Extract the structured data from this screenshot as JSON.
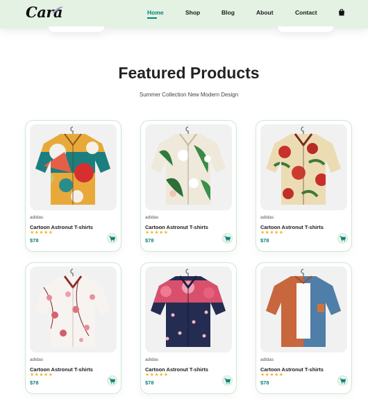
{
  "header": {
    "logo_text": "Cara",
    "nav": [
      {
        "label": "Home",
        "active": true
      },
      {
        "label": "Shop",
        "active": false
      },
      {
        "label": "Blog",
        "active": false
      },
      {
        "label": "About",
        "active": false
      },
      {
        "label": "Contact",
        "active": false
      }
    ],
    "bag_icon": "shopping-bag-icon"
  },
  "section": {
    "title": "Featured Products",
    "subtitle": "Summer Collection New Modern Design"
  },
  "colors": {
    "accent": "#088178",
    "header_bg": "#e3f2e3",
    "star": "#f3b52c",
    "card_border": "#cce7d0"
  },
  "products": [
    {
      "brand": "adidas",
      "name": "Cartoon Astronut T-shirts",
      "stars": "★★★★★",
      "price": "$78",
      "image": "yellow-teal-floral-shirt"
    },
    {
      "brand": "adidas",
      "name": "Cartoon Astronut T-shirts",
      "stars": "★★★★★",
      "price": "$78",
      "image": "white-green-leaf-shirt"
    },
    {
      "brand": "adidas",
      "name": "Cartoon Astronut T-shirts",
      "stars": "★★★★★",
      "price": "$78",
      "image": "beige-red-floral-shirt"
    },
    {
      "brand": "adidas",
      "name": "Cartoon Astronut T-shirts",
      "stars": "★★★★★",
      "price": "$78",
      "image": "white-pink-blossom-shirt"
    },
    {
      "brand": "adidas",
      "name": "Cartoon Astronut T-shirts",
      "stars": "★★★★★",
      "price": "$78",
      "image": "navy-pink-floral-shirt"
    },
    {
      "brand": "adidas",
      "name": "Cartoon Astronut T-shirts",
      "stars": "★★★★★",
      "price": "$78",
      "image": "orange-denim-overshirt"
    }
  ],
  "cart_icon": "cart-icon"
}
